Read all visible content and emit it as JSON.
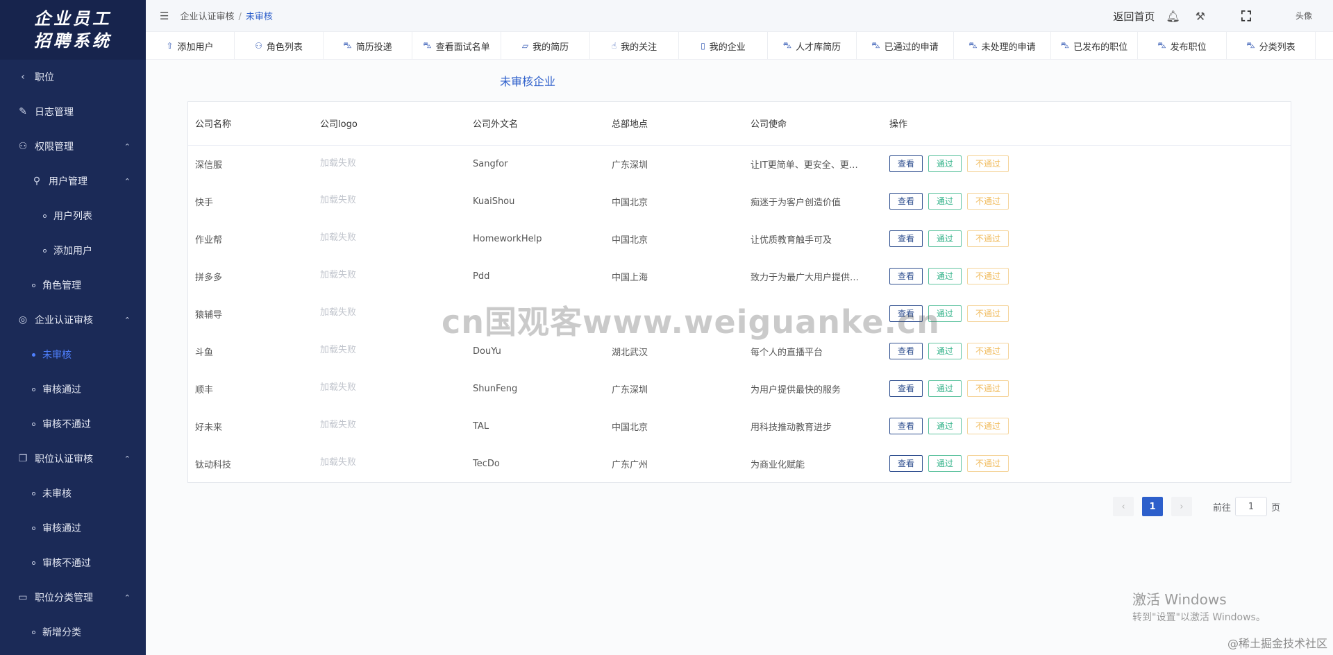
{
  "brand": {
    "line1": "企业员工",
    "line2": "招聘系统"
  },
  "sidebar": {
    "items": [
      {
        "label": "职位",
        "icon": "chevron-left-icon",
        "glyph": "‹",
        "level": "l0"
      },
      {
        "label": "日志管理",
        "icon": "log-icon",
        "glyph": "✎",
        "level": "l0"
      },
      {
        "label": "权限管理",
        "icon": "user-lock-icon",
        "glyph": "⚇",
        "level": "l0",
        "arrow": "⌃"
      },
      {
        "label": "用户管理",
        "icon": "user-manage-icon",
        "glyph": "⚲",
        "level": "l1",
        "arrow": "⌃"
      },
      {
        "label": "用户列表",
        "level": "l2",
        "dot": true
      },
      {
        "label": "添加用户",
        "level": "l2",
        "dot": true
      },
      {
        "label": "角色管理",
        "level": "sub",
        "dot": true
      },
      {
        "label": "企业认证审核",
        "icon": "toggle-icon",
        "glyph": "◎",
        "level": "l0",
        "arrow": "⌃"
      },
      {
        "label": "未审核",
        "level": "sub",
        "dot": true,
        "active": true
      },
      {
        "label": "审核通过",
        "level": "sub",
        "dot": true
      },
      {
        "label": "审核不通过",
        "level": "sub",
        "dot": true
      },
      {
        "label": "职位认证审核",
        "icon": "copy-icon",
        "glyph": "❐",
        "level": "l0",
        "arrow": "⌃"
      },
      {
        "label": "未审核",
        "level": "sub",
        "dot": true
      },
      {
        "label": "审核通过",
        "level": "sub",
        "dot": true
      },
      {
        "label": "审核不通过",
        "level": "sub",
        "dot": true
      },
      {
        "label": "职位分类管理",
        "icon": "video-icon",
        "glyph": "▭",
        "level": "l0",
        "arrow": "⌃"
      },
      {
        "label": "新增分类",
        "level": "sub",
        "dot": true
      }
    ]
  },
  "header": {
    "breadcrumb_parent": "企业认证审核",
    "breadcrumb_sep": "/",
    "breadcrumb_current": "未审核",
    "home_label": "返回首页",
    "avatar_alt": "头像"
  },
  "tabs": [
    {
      "label": "添加用户",
      "icon": "rocket-icon",
      "glyph": "⇧",
      "width": 128
    },
    {
      "label": "角色列表",
      "icon": "user-settings-icon",
      "glyph": "⚇",
      "width": 128
    },
    {
      "label": "简历投递",
      "icon": "car-icon",
      "glyph": "⛍",
      "width": 128
    },
    {
      "label": "查看面试名单",
      "icon": "car-icon",
      "glyph": "⛍",
      "width": 128
    },
    {
      "label": "我的简历",
      "icon": "folder-icon",
      "glyph": "▱",
      "width": 128
    },
    {
      "label": "我的关注",
      "icon": "hand-icon",
      "glyph": "☝",
      "width": 128
    },
    {
      "label": "我的企业",
      "icon": "phone-icon",
      "glyph": "▯",
      "width": 128
    },
    {
      "label": "人才库简历",
      "icon": "car-icon",
      "glyph": "⛍",
      "width": 128
    },
    {
      "label": "已通过的申请",
      "icon": "car-icon",
      "glyph": "⛍",
      "width": 140
    },
    {
      "label": "未处理的申请",
      "icon": "car-icon",
      "glyph": "⛍",
      "width": 140
    },
    {
      "label": "已发布的职位",
      "icon": "car-icon",
      "glyph": "⛍",
      "width": 125
    },
    {
      "label": "发布职位",
      "icon": "car-icon",
      "glyph": "⛍",
      "width": 128
    },
    {
      "label": "分类列表",
      "icon": "car-icon",
      "glyph": "⛍",
      "width": 128
    }
  ],
  "page": {
    "title": "未审核企业"
  },
  "table": {
    "columns": [
      "公司名称",
      "公司logo",
      "公司外文名",
      "总部地点",
      "公司使命",
      "操作"
    ],
    "rows": [
      {
        "name": "深信服",
        "logo": "加载失败",
        "foreign": "Sangfor",
        "hq": "广东深圳",
        "mission": "让IT更简单、更安全、更…"
      },
      {
        "name": "快手",
        "logo": "加载失败",
        "foreign": "KuaiShou",
        "hq": "中国北京",
        "mission": "痴迷于为客户创造价值"
      },
      {
        "name": "作业帮",
        "logo": "加载失败",
        "foreign": "HomeworkHelp",
        "hq": "中国北京",
        "mission": "让优质教育触手可及"
      },
      {
        "name": "拼多多",
        "logo": "加载失败",
        "foreign": "Pdd",
        "hq": "中国上海",
        "mission": "致力于为最广大用户提供…"
      },
      {
        "name": "猿辅导",
        "logo": "加载失败",
        "foreign": "",
        "hq": "",
        "mission": ""
      },
      {
        "name": "斗鱼",
        "logo": "加载失败",
        "foreign": "DouYu",
        "hq": "湖北武汉",
        "mission": "每个人的直播平台"
      },
      {
        "name": "顺丰",
        "logo": "加载失败",
        "foreign": "ShunFeng",
        "hq": "广东深圳",
        "mission": "为用户提供最快的服务"
      },
      {
        "name": "好未来",
        "logo": "加载失败",
        "foreign": "TAL",
        "hq": "中国北京",
        "mission": "用科技推动教育进步"
      },
      {
        "name": "钛动科技",
        "logo": "加载失败",
        "foreign": "TecDo",
        "hq": "广东广州",
        "mission": "为商业化赋能"
      }
    ],
    "actions": {
      "view": "查看",
      "pass": "通过",
      "fail": "不通过"
    }
  },
  "pagination": {
    "prev": "‹",
    "current": "1",
    "next": "›",
    "goto_prefix": "前往",
    "goto_value": "1",
    "goto_suffix": "页"
  },
  "watermark": "cn国观客www.weiguanke.cn",
  "windows_activation": {
    "line1": "激活 Windows",
    "line2": "转到\"设置\"以激活 Windows。"
  },
  "community": "@稀土掘金技术社区",
  "colors": {
    "sidebar": "#1b2a57",
    "accent": "#2d5fcb",
    "pass": "#34b38a",
    "fail": "#f0ba5a"
  }
}
